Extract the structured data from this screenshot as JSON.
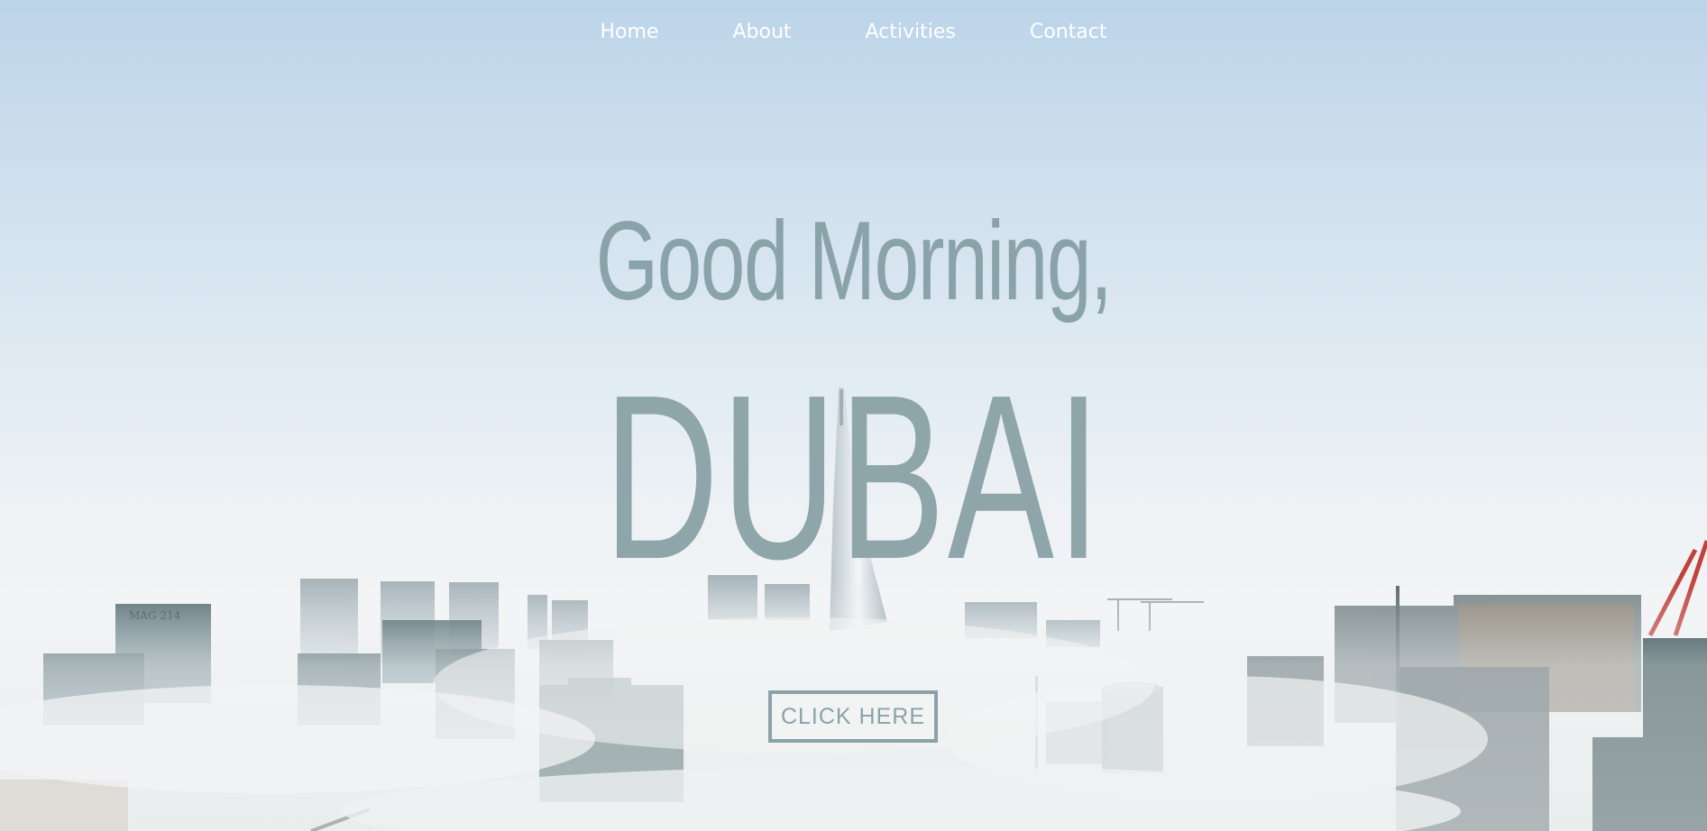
{
  "nav": {
    "items": [
      {
        "label": "Home"
      },
      {
        "label": "About"
      },
      {
        "label": "Activities"
      },
      {
        "label": "Contact"
      }
    ]
  },
  "hero": {
    "greeting": "Good Morning,",
    "city": "DUBAI",
    "cta_label": "CLICK HERE",
    "building_sign": "MAG 214"
  },
  "colors": {
    "nav_text": "#ffffff",
    "heading": "#8aa3a8",
    "button_border": "#8aa3a8",
    "sky_top": "#bcd4e9",
    "fog": "#eef2f5"
  }
}
